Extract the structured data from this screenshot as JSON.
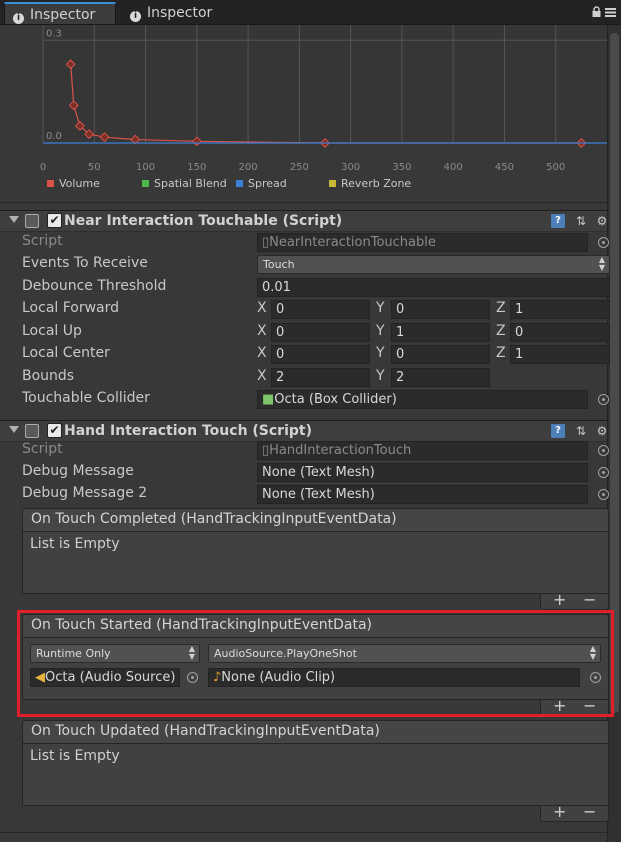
{
  "tabs": [
    {
      "label": "Inspector",
      "icon": "info-icon",
      "active": true
    },
    {
      "label": "Inspector",
      "icon": "info-icon",
      "active": false
    }
  ],
  "window_controls": {
    "lock_icon": "lock-icon",
    "menu_icon": "menu-icon"
  },
  "curve_panel": {
    "y_ticks": [
      "0.3",
      "0.0"
    ],
    "x_ticks": [
      "0",
      "50",
      "100",
      "150",
      "200",
      "250",
      "300",
      "350",
      "400",
      "450",
      "500"
    ],
    "legend": [
      {
        "label": "Volume",
        "color": "#d9534a"
      },
      {
        "label": "Spatial Blend",
        "color": "#4cb84a"
      },
      {
        "label": "Spread",
        "color": "#3c7fd6"
      },
      {
        "label": "Reverb Zone",
        "color": "#c8b636"
      }
    ],
    "colors": {
      "curve": "#d9534a",
      "baseline": "#3c7fd6",
      "grid": "#555555"
    }
  },
  "chart_data": {
    "type": "line",
    "xlim": [
      0,
      550
    ],
    "ylim": [
      0,
      0.33
    ],
    "series": [
      {
        "name": "Volume",
        "x": [
          27,
          30,
          36,
          45,
          60,
          90,
          150,
          275,
          525
        ],
        "y": [
          0.23,
          0.11,
          0.05,
          0.026,
          0.017,
          0.01,
          0.005,
          0.0,
          0.0
        ]
      },
      {
        "name": "Spread",
        "x": [
          0,
          550
        ],
        "y": [
          0,
          0
        ]
      }
    ]
  },
  "near_touchable": {
    "title": "Near Interaction Touchable (Script)",
    "enabled_mark": "✔",
    "script_label": "Script",
    "script_value": "NearInteractionTouchable",
    "events_label": "Events To Receive",
    "events_value": "Touch",
    "debounce_label": "Debounce Threshold",
    "debounce_value": "0.01",
    "local_forward_label": "Local Forward",
    "local_forward": {
      "x": "0",
      "y": "0",
      "z": "1"
    },
    "local_up_label": "Local Up",
    "local_up": {
      "x": "0",
      "y": "1",
      "z": "0"
    },
    "local_center_label": "Local Center",
    "local_center": {
      "x": "0",
      "y": "0",
      "z": "1"
    },
    "bounds_label": "Bounds",
    "bounds": {
      "x": "2",
      "y": "2"
    },
    "collider_label": "Touchable Collider",
    "collider_value": "Octa (Box Collider)"
  },
  "axis_labels": {
    "x": "X",
    "y": "Y",
    "z": "Z"
  },
  "hand_touch": {
    "title": "Hand Interaction Touch (Script)",
    "enabled_mark": "✔",
    "script_label": "Script",
    "script_value": "HandInteractionTouch",
    "debug_label": "Debug Message",
    "debug_value": "None (Text Mesh)",
    "debug2_label": "Debug Message 2",
    "debug2_value": "None (Text Mesh)"
  },
  "events": {
    "completed_title": "On Touch Completed (HandTrackingInputEventData)",
    "completed_empty": "List is Empty",
    "started_title": "On Touch Started (HandTrackingInputEventData)",
    "started_mode": "Runtime Only",
    "started_function": "AudioSource.PlayOneShot",
    "started_target": "Octa (Audio Source)",
    "started_argument": "None (Audio Clip)",
    "updated_title": "On Touch Updated (HandTrackingInputEventData)",
    "updated_empty": "List is Empty",
    "plus": "+",
    "minus": "−"
  },
  "highlight_color": "#e01f2b"
}
